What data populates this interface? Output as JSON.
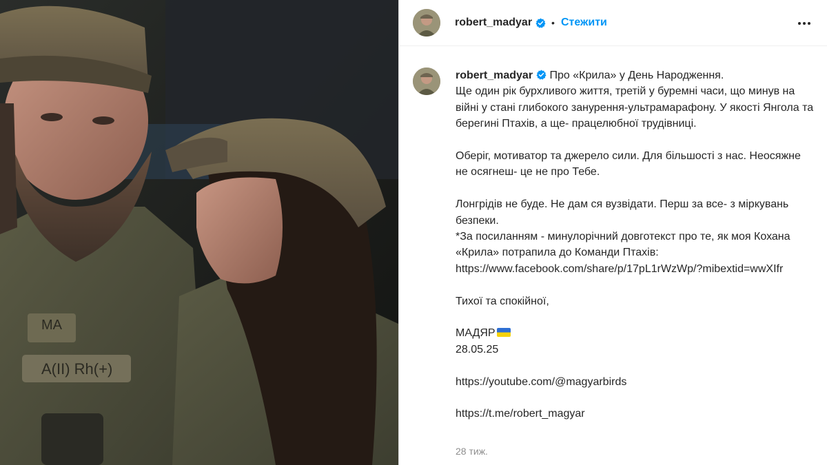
{
  "header": {
    "username": "robert_madyar",
    "dot": "•",
    "follow_label": "Стежити"
  },
  "caption": {
    "username": "robert_madyar",
    "lines": [
      "Про «Крила» у День Народження.",
      "Ще один рік бурхливого життя, третій у буремні часи, що минув на війні у стані глибокого занурення-ультрамарафону. У якості Янгола та берегині Птахів, а ще- працелюбної трудівниці.",
      "",
      "Оберіг, мотиватор та джерело сили. Для більшості з нас. Неосяжне не осягнеш- це не про Тебе.",
      "",
      "Лонгрідів не буде. Не дам ся вузвідати. Перш за все- з міркувань безпеки.",
      "*За посиланням - минулорічний довготекст про те, як моя Кохана «Крила» потрапила до Команди Птахів:",
      "https://www.facebook.com/share/p/17pL1rWzWp/?mibextid=wwXIfr",
      "",
      "Тихої та спокійної,",
      "",
      "МАДЯР",
      "28.05.25",
      "",
      "https://youtube.com/@magyarbirds",
      "",
      "https://t.me/robert_magyar"
    ]
  },
  "timestamp": "28 тиж.",
  "icons": {
    "verified": "verified-badge-icon",
    "more": "more-options-icon",
    "flag": "ukraine-flag-emoji"
  },
  "colors": {
    "accent": "#0095f6",
    "text": "#262626",
    "muted": "#8e8e8e"
  }
}
